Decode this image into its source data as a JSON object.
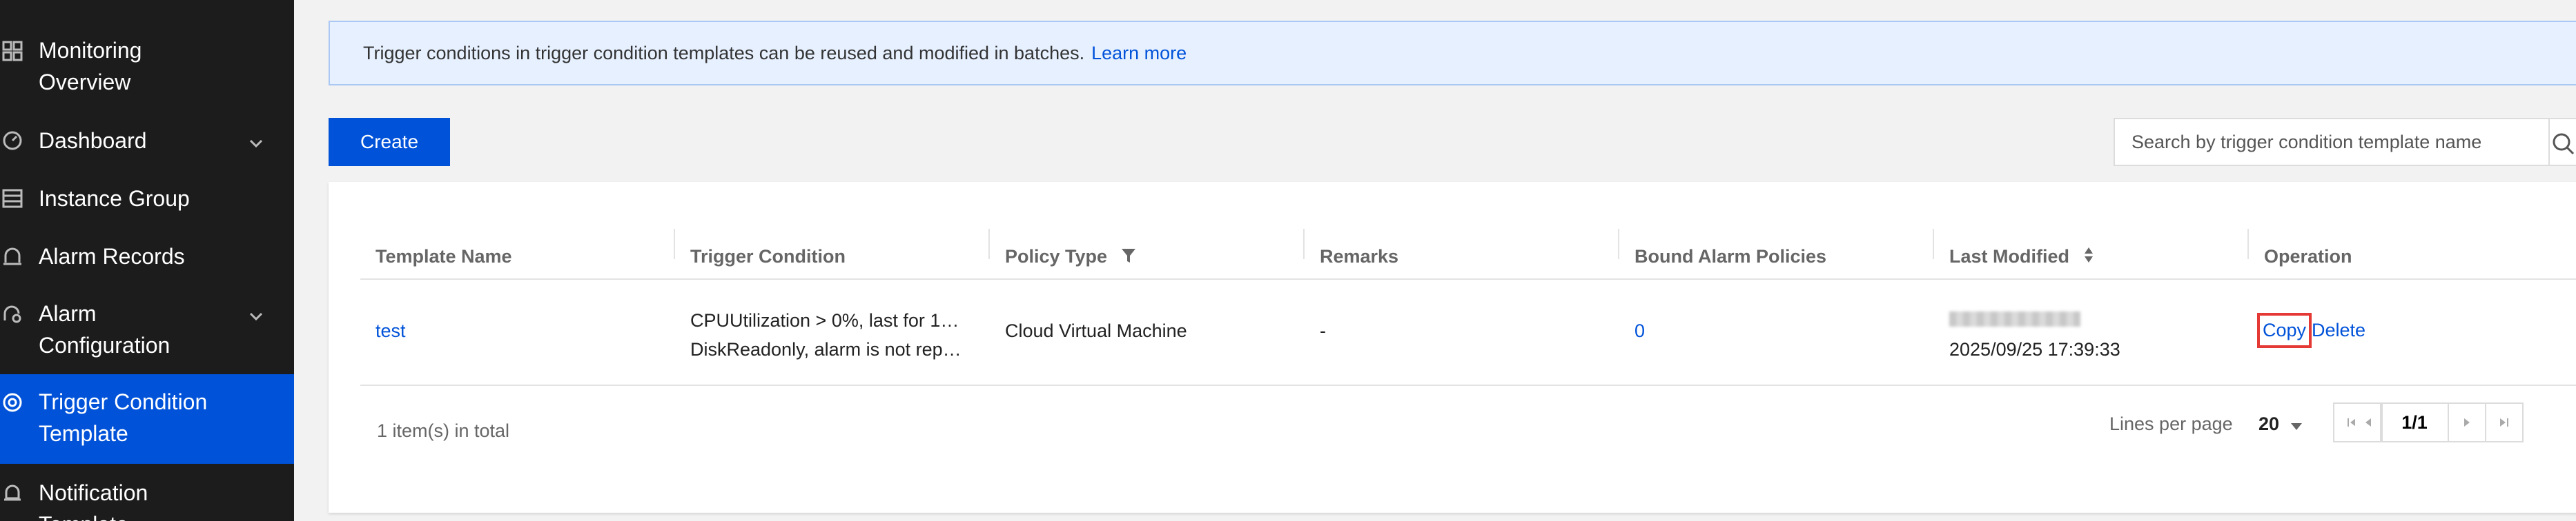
{
  "sidebar": {
    "items": [
      {
        "label_line1": "Monitoring",
        "label_line2": "Overview",
        "icon": "grid-icon"
      },
      {
        "label": "Dashboard",
        "icon": "gauge-icon",
        "expandable": true
      },
      {
        "label": "Instance Group",
        "icon": "list-icon"
      },
      {
        "label": "Alarm Records",
        "icon": "bell-record-icon"
      },
      {
        "label_line1": "Alarm",
        "label_line2": "Configuration",
        "icon": "alarm-config-icon",
        "expandable": true
      },
      {
        "label_line1": "Trigger Condition",
        "label_line2": "Template",
        "icon": "target-icon",
        "active": true
      },
      {
        "label_line1": "Notification",
        "label_line2": "Template",
        "icon": "bell-icon"
      }
    ]
  },
  "banner": {
    "text": "Trigger conditions in trigger condition templates can be reused and modified in batches.",
    "link": "Learn more"
  },
  "toolbar": {
    "create_label": "Create",
    "search_placeholder": "Search by trigger condition template name"
  },
  "table": {
    "columns": [
      "Template Name",
      "Trigger Condition",
      "Policy Type",
      "Remarks",
      "Bound Alarm Policies",
      "Last Modified",
      "Operation"
    ],
    "rows": [
      {
        "template_name": "test",
        "condition_line1": "CPUUtilization > 0%, last for 1…",
        "condition_line2": "DiskReadonly, alarm is not rep…",
        "policy_type": "Cloud Virtual Machine",
        "remarks": "-",
        "bound_policies": "0",
        "last_modified": "2025/09/25 17:39:33",
        "op_copy": "Copy",
        "op_delete": "Delete"
      }
    ]
  },
  "footer": {
    "total": "1 item(s) in total",
    "lines_per_page_label": "Lines per page",
    "lines_per_page_value": "20",
    "page": "1/1"
  },
  "colors": {
    "accent": "#0052d9",
    "sidebar_bg": "#1c1c1c",
    "highlight_box": "#e53935"
  }
}
